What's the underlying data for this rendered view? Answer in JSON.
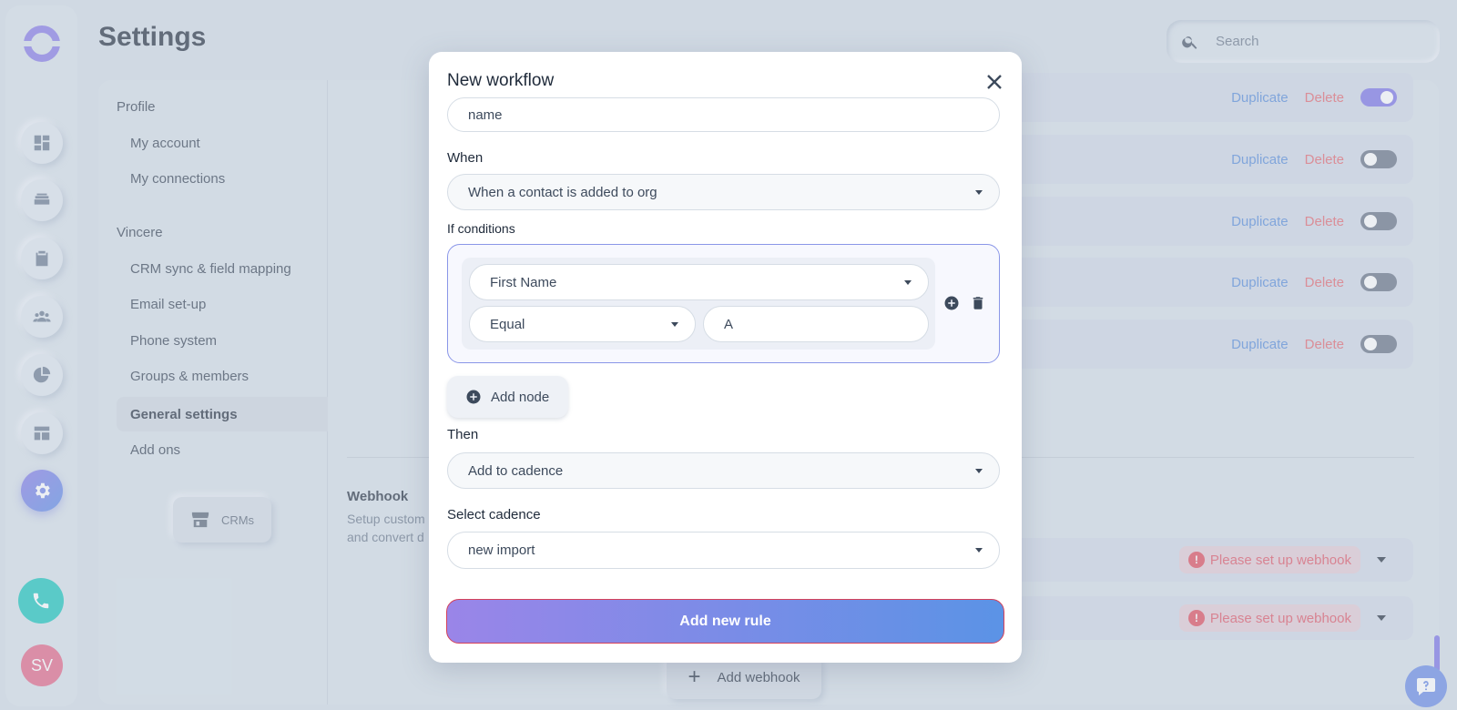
{
  "app": {
    "title": "Settings",
    "avatar_initials": "SV"
  },
  "search": {
    "placeholder": "Search"
  },
  "nav": {
    "section_profile": "Profile",
    "profile_items": [
      "My account",
      "My connections"
    ],
    "section_org": "Vincere",
    "org_items": [
      "CRM sync & field mapping",
      "Email set-up",
      "Phone system",
      "Groups & members",
      "General settings",
      "Add ons"
    ],
    "active_item": "General settings",
    "crm_button": "CRMs"
  },
  "workflows": {
    "rows": [
      {
        "duplicate": "Duplicate",
        "delete": "Delete",
        "enabled": true
      },
      {
        "duplicate": "Duplicate",
        "delete": "Delete",
        "enabled": false
      },
      {
        "duplicate": "Duplicate",
        "delete": "Delete",
        "enabled": false
      },
      {
        "duplicate": "Duplicate",
        "delete": "Delete",
        "enabled": false
      },
      {
        "duplicate": "Duplicate",
        "delete": "Delete",
        "enabled": false
      }
    ]
  },
  "webhook": {
    "title": "Webhook",
    "desc_line1": "Setup custom",
    "desc_line2": "and convert d",
    "rows": [
      {
        "warning": "Please set up webhook"
      },
      {
        "warning": "Please set up webhook"
      }
    ],
    "add_label": "Add webhook"
  },
  "modal": {
    "title": "New workflow",
    "name_value": "name",
    "when_label": "When",
    "when_value": "When a contact is added to org",
    "if_label": "If conditions",
    "condition": {
      "field": "First Name",
      "operator": "Equal",
      "value": "A"
    },
    "add_node_label": "Add node",
    "then_label": "Then",
    "then_value": "Add to cadence",
    "cadence_label": "Select cadence",
    "cadence_value": "new import",
    "submit_label": "Add new rule"
  },
  "colors": {
    "accent_start": "#9a85e8",
    "accent_end": "#5b93e6",
    "danger": "#e46b73",
    "link": "#5a8edb",
    "phone": "#1fc7be",
    "avatar": "#e46a8b"
  }
}
